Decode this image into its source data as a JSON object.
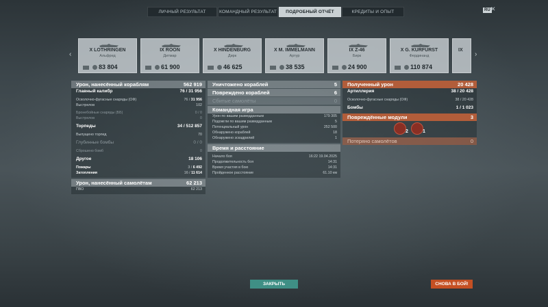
{
  "tabs": [
    "ЛИЧНЫЙ РЕЗУЛЬТАТ",
    "КОМАНДНЫЙ РЕЗУЛЬТАТ",
    "ПОДРОБНЫЙ ОТЧЁТ",
    "КРЕДИТЫ И ОПЫТ"
  ],
  "active_tab": "ПОДРОБНЫЙ ОТЧЁТ",
  "lang_badge": "RU",
  "close_glyph": "✕",
  "nav": {
    "prev": "‹",
    "next": "›"
  },
  "ships": [
    {
      "name": "X LOTHRINGEN",
      "player": "Альфред",
      "damage": "83 804"
    },
    {
      "name": "IX ROON",
      "player": "Дитмар",
      "damage": "61 900"
    },
    {
      "name": "X HINDENBURG",
      "player": "Дирк",
      "damage": "46 625"
    },
    {
      "name": "X M. IMMELMANN",
      "player": "Артур",
      "damage": "38 535"
    },
    {
      "name": "IX Z-46",
      "player": "Бирк",
      "damage": "24 900"
    },
    {
      "name": "X G. KURFÜRST",
      "player": "Фердинанд",
      "damage": "110 874"
    },
    {
      "name": "IX",
      "player": "",
      "damage": ""
    }
  ],
  "left": {
    "damage_header": {
      "label": "Урон, нанесённый кораблям",
      "value": "562 919"
    },
    "main_battery": {
      "label": "Главный калибр",
      "value_a": "76",
      "value_b": "31 956"
    },
    "he_shells": {
      "label": "Осколочно-фугасные снаряды (ОФ)",
      "value_a": "76",
      "value_b": "31 956"
    },
    "shots": {
      "label": "Выстрелов",
      "value": "102"
    },
    "ap_shells": {
      "label": "Бронебойные снаряды (ББ)",
      "value": "0 / 0"
    },
    "ap_shots": {
      "label": "Выстрелов",
      "value": "0"
    },
    "torpedoes": {
      "label": "Торпеды",
      "value_a": "34",
      "value_b": "512 857"
    },
    "torp_launched": {
      "label": "Выпущено торпед",
      "value": "70"
    },
    "depth_charges": {
      "label": "Глубинные бомбы",
      "value": "0 / 0"
    },
    "dc_dropped": {
      "label": "Сброшено бомб",
      "value": "0"
    },
    "other": {
      "label": "Другое",
      "value": "18 106"
    },
    "fires": {
      "label": "Пожары",
      "value_a": "3",
      "value_b": "6 492"
    },
    "floods": {
      "label": "Затопления",
      "value_a": "16",
      "value_b": "11 614"
    },
    "aircraft_header": {
      "label": "Урон, нанесённый самолётам",
      "value": "62 213"
    },
    "aa": {
      "label": "ПВО",
      "value": "62 213"
    }
  },
  "middle": {
    "destroyed": {
      "label": "Уничтожено кораблей",
      "value": "5"
    },
    "damaged": {
      "label": "Повреждено кораблей",
      "value": "6"
    },
    "planes_shot": {
      "label": "Сбитые самолёты",
      "value": "0"
    },
    "team_header": "Командная игра",
    "team_rows": [
      {
        "label": "Урон по вашим разведданным",
        "value": "179 305"
      },
      {
        "label": "Подожгли по вашим разведданным",
        "value": "5"
      },
      {
        "label": "Потенциальный урон",
        "value": "252 500"
      },
      {
        "label": "Обнаружено кораблей",
        "value": "18"
      },
      {
        "label": "Обнаружено эскадрилий",
        "value": "1"
      }
    ],
    "time_header": "Время и расстояние",
    "time_rows": [
      {
        "label": "Начало боя",
        "value": "16:22  19.04.2025"
      },
      {
        "label": "Продолжительность боя",
        "value": "14:31"
      },
      {
        "label": "Время участия в бою",
        "value": "14:31"
      },
      {
        "label": "Пройденное расстояние",
        "value": "61.10 км"
      }
    ]
  },
  "right": {
    "received": {
      "label": "Полученный урон",
      "value": "20 428"
    },
    "artillery": {
      "label": "Артиллерия",
      "value_a": "38",
      "value_b": "20 428"
    },
    "he_recv": {
      "label": "Осколочно-фугасные снаряды (ОФ)",
      "value": "38 / 20 428"
    },
    "bombs": {
      "label": "Бомбы",
      "value": "1 / 1 023"
    },
    "modules": {
      "label": "Повреждённые модули",
      "value": "3"
    },
    "module_icons": [
      {
        "name": "torpedo-tube-icon",
        "count": "2"
      },
      {
        "name": "engine-icon",
        "count": "1"
      }
    ],
    "planes_lost": {
      "label": "Потеряно самолётов",
      "value": "0"
    }
  },
  "buttons": {
    "close": "ЗАКРЫТЬ",
    "again": "СНОВА В БОЙ!"
  }
}
